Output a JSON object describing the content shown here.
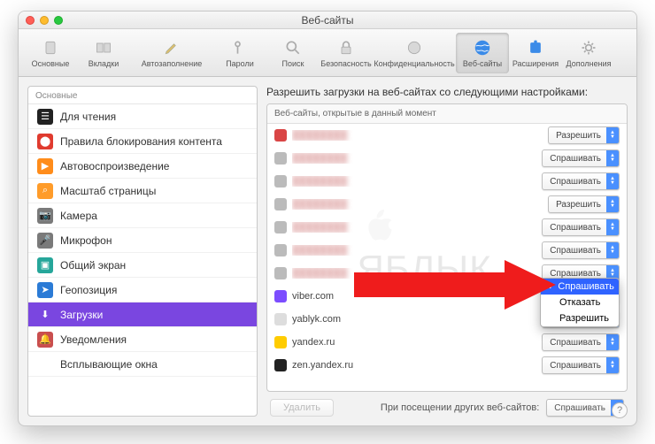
{
  "window": {
    "title": "Веб-сайты"
  },
  "toolbar": [
    {
      "label": "Основные",
      "icon": "gear"
    },
    {
      "label": "Вкладки",
      "icon": "tabs"
    },
    {
      "label": "Автозаполнение",
      "icon": "pencil"
    },
    {
      "label": "Пароли",
      "icon": "key"
    },
    {
      "label": "Поиск",
      "icon": "search"
    },
    {
      "label": "Безопасность",
      "icon": "lock"
    },
    {
      "label": "Конфиденциальность",
      "icon": "privacy"
    },
    {
      "label": "Веб-сайты",
      "icon": "globe",
      "selected": true
    },
    {
      "label": "Расширения",
      "icon": "puzzle"
    },
    {
      "label": "Дополнения",
      "icon": "cog"
    }
  ],
  "sidebar": {
    "title": "Основные",
    "items": [
      {
        "label": "Для чтения",
        "icon": "reader",
        "color": "#222"
      },
      {
        "label": "Правила блокирования контента",
        "icon": "stop",
        "color": "#e03b2f"
      },
      {
        "label": "Автовоспроизведение",
        "icon": "play",
        "color": "#ff8c1a"
      },
      {
        "label": "Масштаб страницы",
        "icon": "zoom",
        "color": "#ff9c2a"
      },
      {
        "label": "Камера",
        "icon": "camera",
        "color": "#7a7a7a"
      },
      {
        "label": "Микрофон",
        "icon": "mic",
        "color": "#7a7a7a"
      },
      {
        "label": "Общий экран",
        "icon": "screen",
        "color": "#26a69a"
      },
      {
        "label": "Геопозиция",
        "icon": "geo",
        "color": "#2b7bd6"
      },
      {
        "label": "Загрузки",
        "icon": "download",
        "color": "#7a46e0",
        "selected": true
      },
      {
        "label": "Уведомления",
        "icon": "bell",
        "color": "#c94e4e"
      },
      {
        "label": "Всплывающие окна",
        "icon": "popup",
        "color": "#fff"
      }
    ]
  },
  "main": {
    "heading": "Разрешить загрузки на веб-сайтах со следующими настройками:",
    "table_head": "Веб-сайты, открытые в данный момент",
    "rows": [
      {
        "host": "hidden",
        "blur": true,
        "fav": "#d94545",
        "value": "Разрешить"
      },
      {
        "host": "hidden",
        "blur": true,
        "fav": "#bbb",
        "value": "Спрашивать"
      },
      {
        "host": "hidden",
        "blur": true,
        "fav": "#bbb",
        "value": "Спрашивать"
      },
      {
        "host": "hidden",
        "blur": true,
        "fav": "#bbb",
        "value": "Разрешить"
      },
      {
        "host": "hidden",
        "blur": true,
        "fav": "#bbb",
        "value": "Спрашивать"
      },
      {
        "host": "hidden",
        "blur": true,
        "fav": "#bbb",
        "value": "Спрашивать"
      },
      {
        "host": "hidden",
        "blur": true,
        "fav": "#bbb",
        "value": "Спрашивать"
      },
      {
        "host": "viber.com",
        "fav": "#7c4dff",
        "value": "Спрашивать",
        "open": true
      },
      {
        "host": "yablyk.com",
        "fav": "#ddd",
        "value": "Спрашивать"
      },
      {
        "host": "yandex.ru",
        "fav": "#ffcc00",
        "value": "Спрашивать"
      },
      {
        "host": "zen.yandex.ru",
        "fav": "#222",
        "value": "Спрашивать"
      }
    ],
    "menu": {
      "items": [
        "Спрашивать",
        "Отказать",
        "Разрешить"
      ],
      "selected": 0
    },
    "delete_label": "Удалить",
    "footer_label": "При посещении других веб-сайтов:",
    "footer_value": "Спрашивать"
  },
  "watermark": "ЯБЛЫК",
  "help": "?"
}
